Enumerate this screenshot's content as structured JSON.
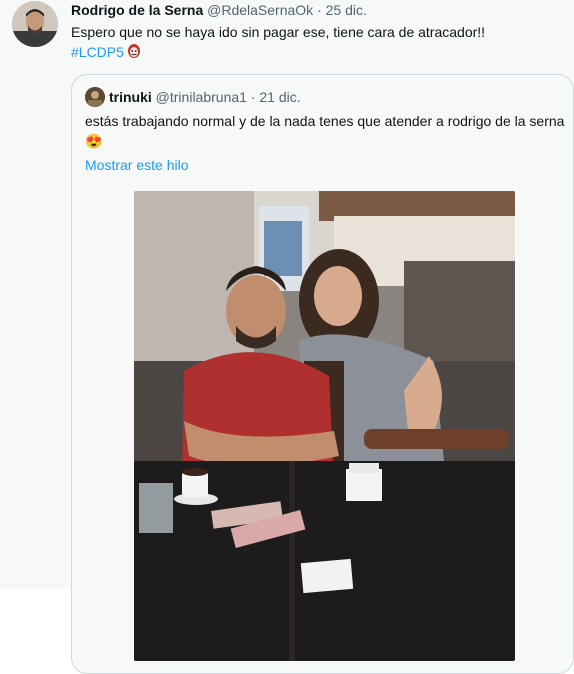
{
  "tweet": {
    "author_name": "Rodrigo de la Serna",
    "author_handle": "@RdelaSernaOk",
    "separator": "·",
    "date": "25 dic.",
    "text_line1": "Espero que no se haya ido sin pagar ese, tiene cara de atracador!!",
    "hashtag": "#LCDP5",
    "avatar_icon": "user-avatar-icon",
    "hashtag_emoji_icon": "money-heist-mask-icon"
  },
  "quoted_tweet": {
    "author_name": "trinuki",
    "author_handle": "@trinilabruna1",
    "separator": "·",
    "date": "21 dic.",
    "text": "estás trabajando normal y de la nada tenes que atender a rodrigo de la serna",
    "emoji": "😍",
    "show_thread": "Mostrar este hilo",
    "avatar_icon": "user-avatar-icon",
    "photo_icon": "photo-image"
  },
  "colors": {
    "accent": "#1d9bf0",
    "text_primary": "#0f1419",
    "text_secondary": "#536471",
    "border": "#cfd9de",
    "background": "#f7f9f9"
  }
}
